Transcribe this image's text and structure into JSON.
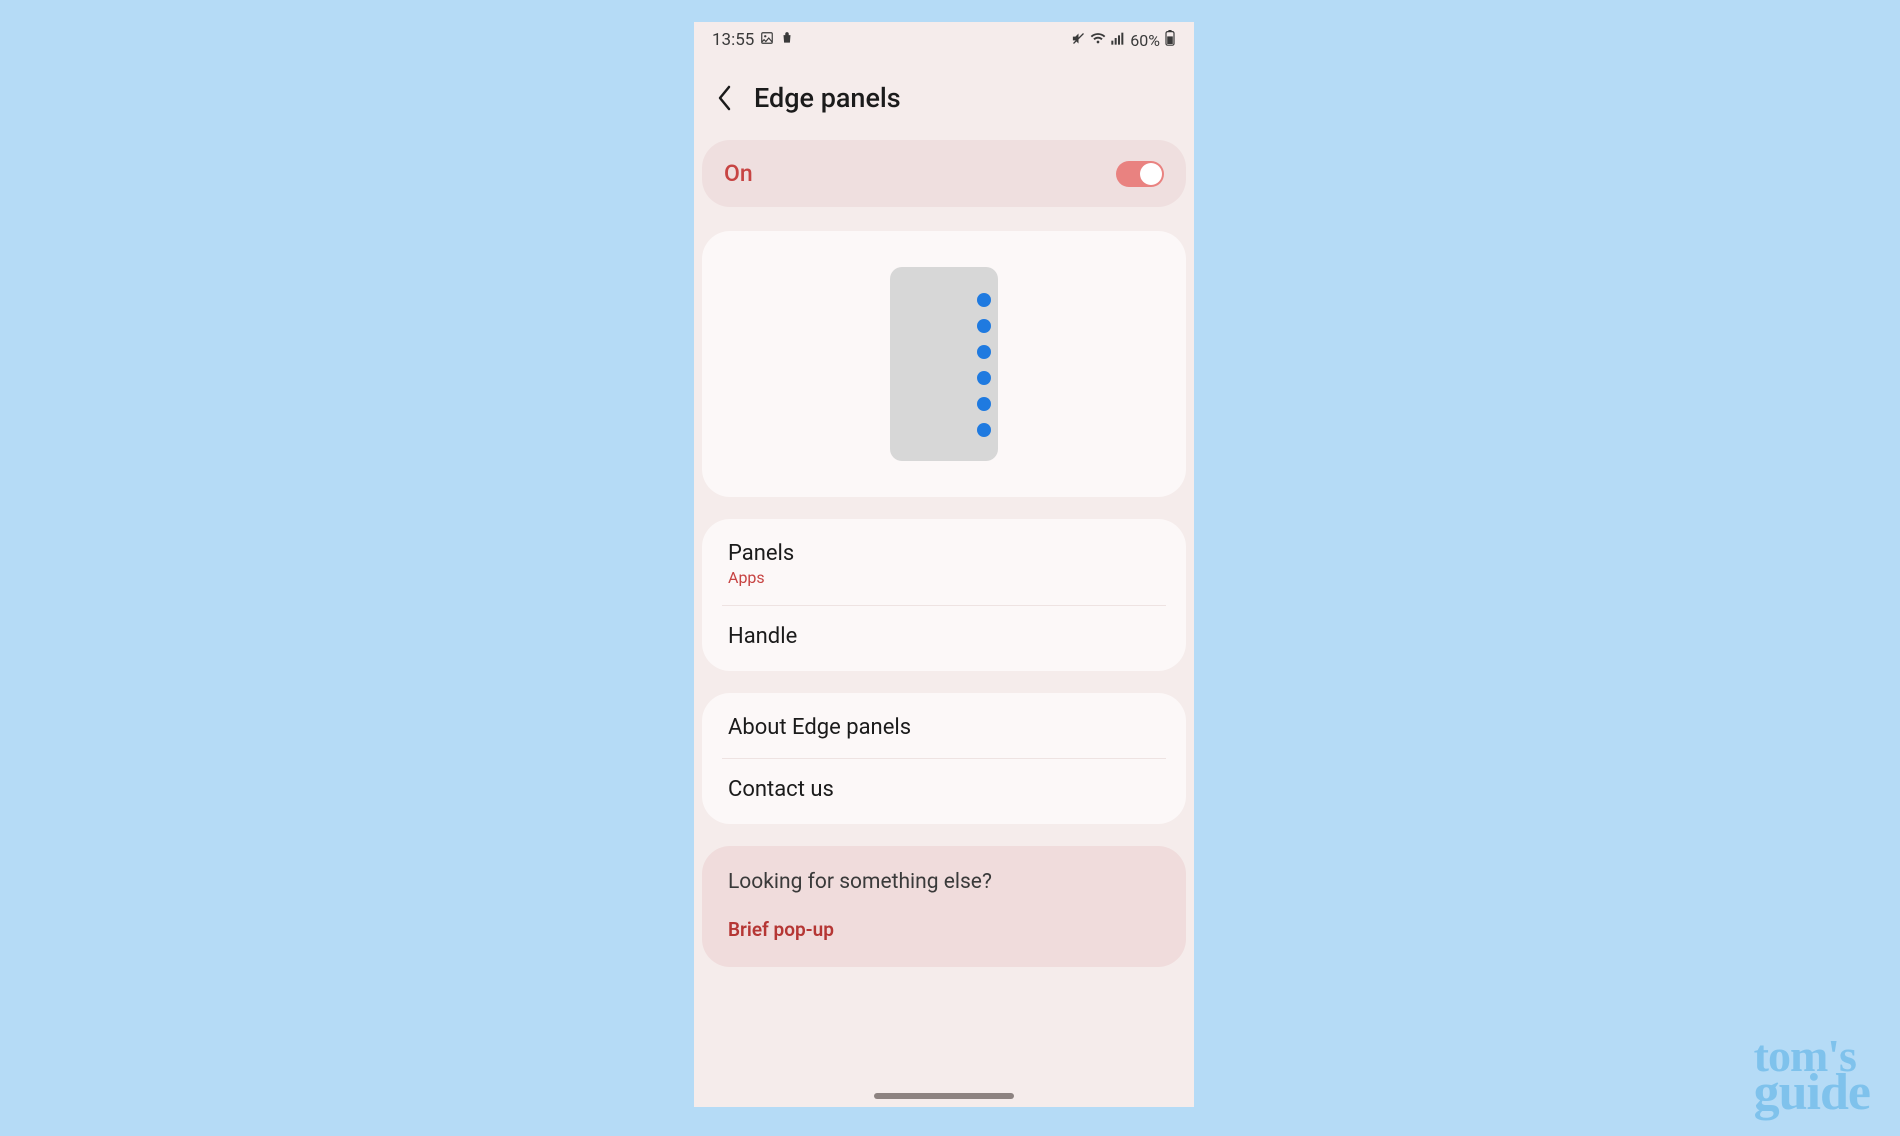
{
  "status": {
    "time": "13:55",
    "battery_text": "60%"
  },
  "header": {
    "title": "Edge panels"
  },
  "toggle": {
    "label": "On",
    "state": true
  },
  "sections": {
    "panels": {
      "title": "Panels",
      "subtitle": "Apps"
    },
    "handle": {
      "title": "Handle"
    },
    "about": {
      "title": "About Edge panels"
    },
    "contact": {
      "title": "Contact us"
    }
  },
  "suggest": {
    "question": "Looking for something else?",
    "link": "Brief pop-up"
  },
  "watermark": {
    "line1": "tom's",
    "line2": "guide"
  }
}
